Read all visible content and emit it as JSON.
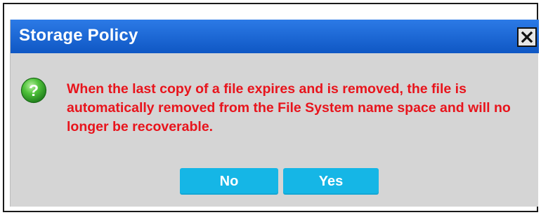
{
  "dialog": {
    "title": "Storage Policy",
    "message": "When the last copy of a file expires and is removed, the file is automatically removed from the File System name space and will no longer be recoverable.",
    "buttons": {
      "no_label": "No",
      "yes_label": "Yes"
    },
    "icons": {
      "close": "close-icon",
      "question": "question-icon"
    }
  },
  "colors": {
    "titlebar": "#1664d0",
    "dialog_background": "#d5d5d5",
    "message_text": "#e8141c",
    "button_background": "#15b6e6",
    "icon_green": "#3cb043"
  }
}
